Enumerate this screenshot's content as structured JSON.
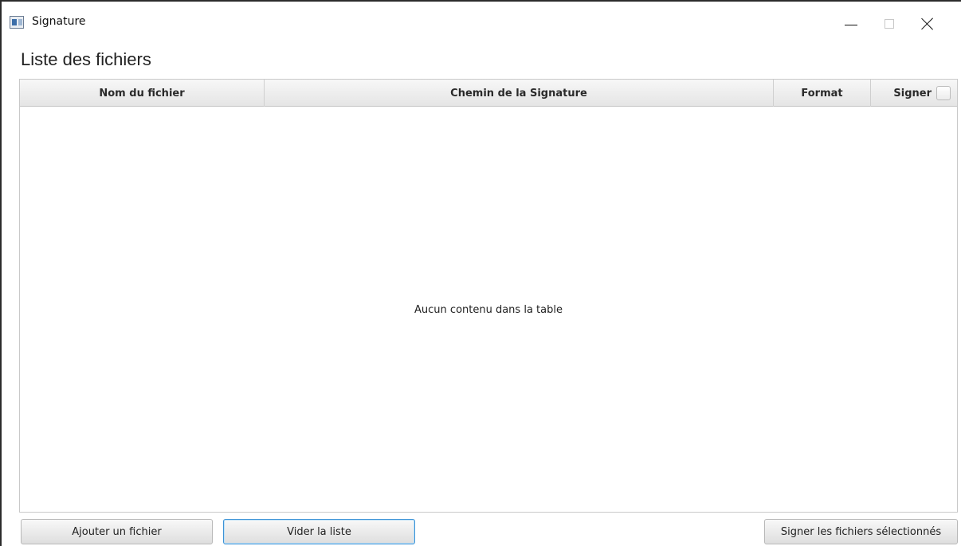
{
  "window": {
    "title": "Signature",
    "app_icon": "app-window-icon",
    "controls": {
      "minimize_icon": "minimize-icon",
      "maximize_icon": "maximize-icon",
      "close_icon": "close-icon"
    }
  },
  "main": {
    "heading": "Liste des fichiers",
    "table": {
      "columns": [
        {
          "label": "Nom du fichier"
        },
        {
          "label": "Chemin de la Signature"
        },
        {
          "label": "Format"
        },
        {
          "label": "Signer"
        }
      ],
      "rows": [],
      "empty_placeholder": "Aucun contenu dans la table"
    }
  },
  "footer": {
    "add_file_label": "Ajouter un fichier",
    "clear_list_label": "Vider la liste",
    "sign_selected_label": "Signer les fichiers sélectionnés"
  },
  "colors": {
    "focus_border": "#3d93d6",
    "title_text": "#111111"
  }
}
